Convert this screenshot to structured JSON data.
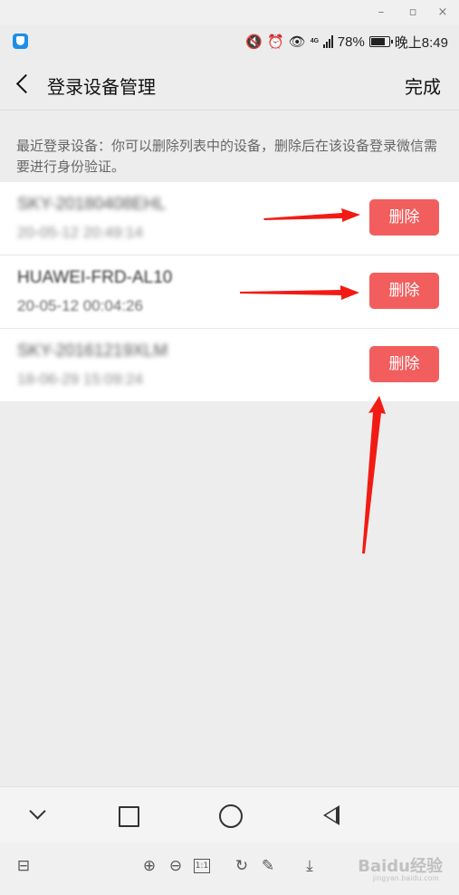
{
  "status_bar": {
    "battery": "78%",
    "battery_level": 0.78,
    "network": "4G",
    "time": "晚上8:49"
  },
  "header": {
    "title": "登录设备管理",
    "done_label": "完成"
  },
  "description": "最近登录设备：你可以删除列表中的设备，删除后在该设备登录微信需要进行身份验证。",
  "devices": [
    {
      "name": "SKY-20180408EHL",
      "time": "20-05-12 20:49:14",
      "delete_label": "删除"
    },
    {
      "name": "HUAWEI-FRD-AL10",
      "time": "20-05-12 00:04:26",
      "delete_label": "删除"
    },
    {
      "name": "SKY-20161219XLM",
      "time": "18-06-29 15:09:24",
      "delete_label": "删除"
    }
  ],
  "viewer": {
    "actual_size_label": "1:1",
    "watermark": "Baidu经验",
    "watermark_url": "jingyan.baidu.com"
  },
  "colors": {
    "delete_button": "#f25e5e",
    "annotation_arrow": "#f21b14"
  }
}
